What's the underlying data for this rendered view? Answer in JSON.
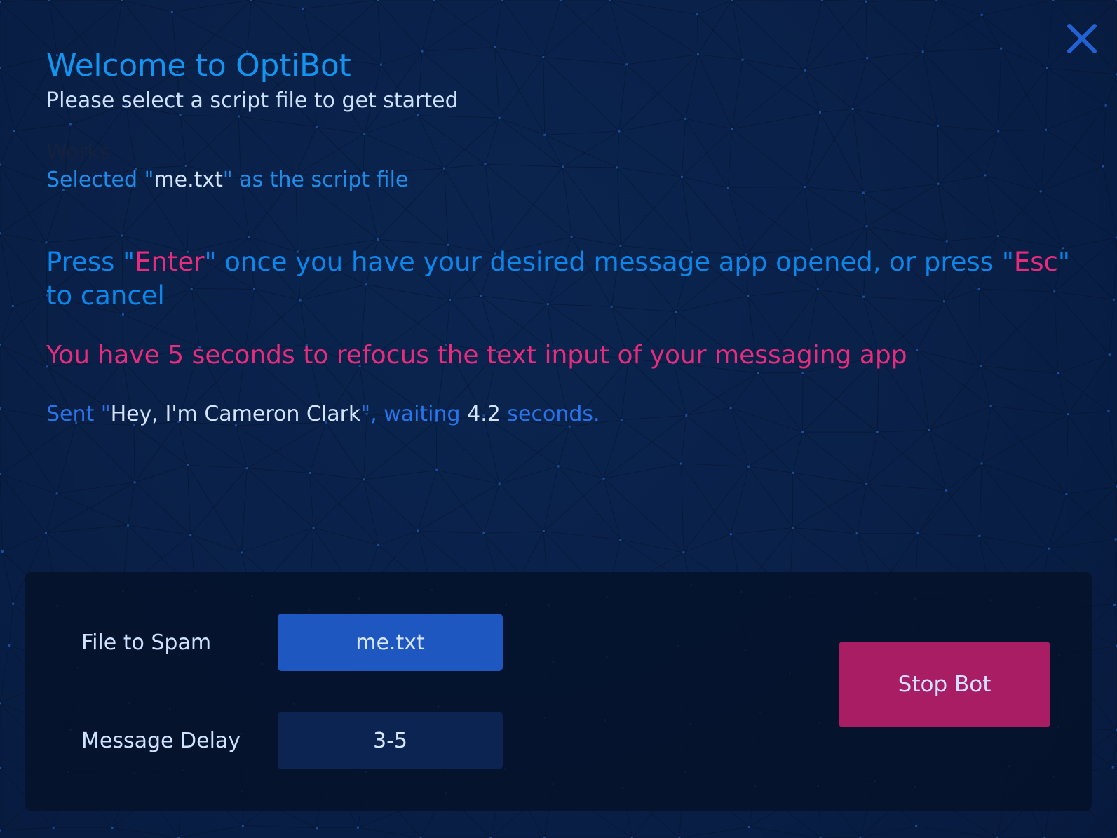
{
  "app": {
    "title": "Welcome to OptiBot",
    "subtitle": "Please select a script file to get started",
    "works_text": "Works"
  },
  "icons": {
    "close": "close-icon"
  },
  "selection": {
    "prefix": "Selected \"",
    "filename": "me.txt",
    "suffix": "\" as the script file"
  },
  "prompt": {
    "part1": "Press \"",
    "enter_key": "Enter",
    "part2": "\" once you have your desired message app opened, or press \"",
    "esc_key": "Esc",
    "part3": "\" to cancel"
  },
  "warning": {
    "text": "You have 5 seconds to refocus the text input of your messaging app"
  },
  "status": {
    "prefix": "Sent \"",
    "message": "Hey, I'm Cameron Clark",
    "middle": "\", waiting ",
    "delay": "4.2",
    "suffix": " seconds."
  },
  "controls": {
    "file_label": "File to Spam",
    "file_value": "me.txt",
    "delay_label": "Message Delay",
    "delay_value": "3-5",
    "stop_label": "Stop Bot"
  },
  "colors": {
    "background": "#071a3d",
    "title_blue": "#1295f1",
    "prompt_blue": "#0b86ea",
    "status_blue": "#2a74ea",
    "text_light": "#cfe2ff",
    "accent_pink": "#e72b7d",
    "file_button": "#1f57c1",
    "stop_button": "#a81d63",
    "panel": "#051128"
  }
}
